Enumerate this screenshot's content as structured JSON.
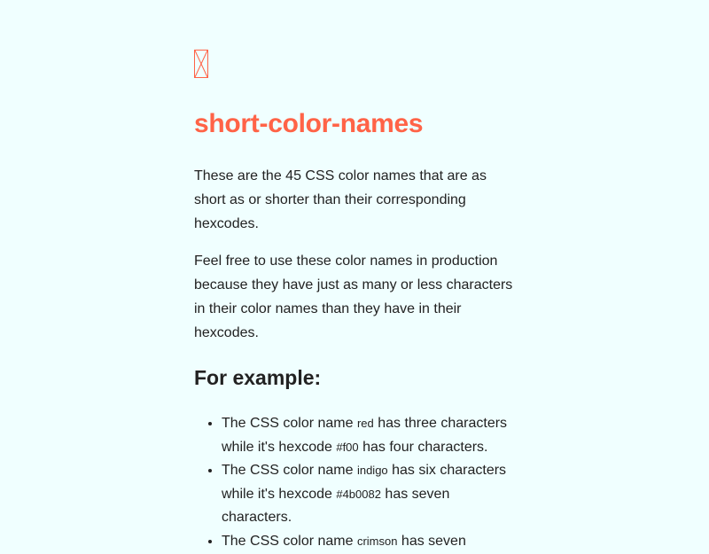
{
  "title": "short-color-names",
  "accent_color": "#ff6347",
  "background_color": "#f0ffff",
  "paragraphs": [
    "These are the 45 CSS color names that are as short as or shorter than their corresponding hexcodes.",
    "Feel free to use these color names in production because they have just as many or less characters in their color names than they have in their hexcodes."
  ],
  "subheading": "For example:",
  "examples": [
    {
      "pre": "The CSS color name ",
      "name": "red",
      "mid": " has three characters while it's hexcode ",
      "hex": "#f00",
      "post": " has four characters."
    },
    {
      "pre": "The CSS color name ",
      "name": "indigo",
      "mid": " has six characters while it's hexcode ",
      "hex": "#4b0082",
      "post": " has seven characters."
    },
    {
      "pre": "The CSS color name ",
      "name": "crimson",
      "mid": " has seven",
      "hex": "",
      "post": ""
    }
  ]
}
